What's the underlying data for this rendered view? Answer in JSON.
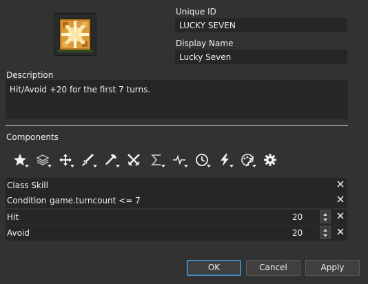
{
  "skill": {
    "unique_id_label": "Unique ID",
    "unique_id": "LUCKY SEVEN",
    "display_name_label": "Display Name",
    "display_name": "Lucky Seven",
    "icon": "sparkle-skill-icon"
  },
  "description": {
    "label": "Description",
    "text": "Hit/Avoid +20 for the first 7 turns."
  },
  "components": {
    "label": "Components",
    "toolbar": [
      {
        "icon": "star-icon"
      },
      {
        "icon": "layers-icon"
      },
      {
        "icon": "move-arrows-icon"
      },
      {
        "icon": "sword-icon"
      },
      {
        "icon": "axe-icon"
      },
      {
        "icon": "crossed-swords-icon"
      },
      {
        "icon": "sigma-icon"
      },
      {
        "icon": "pulse-icon"
      },
      {
        "icon": "clock-icon"
      },
      {
        "icon": "lightning-icon"
      },
      {
        "icon": "palette-icon"
      },
      {
        "icon": "gear-icon"
      }
    ],
    "rows": [
      {
        "name": "Class Skill"
      },
      {
        "name": "Condition",
        "value": "game.turncount <= 7"
      },
      {
        "name": "Hit",
        "value": "20"
      },
      {
        "name": "Avoid",
        "value": "20"
      }
    ]
  },
  "buttons": {
    "ok": "OK",
    "cancel": "Cancel",
    "apply": "Apply"
  },
  "colors": {
    "background": "#323232",
    "field": "#262626",
    "focus_accent": "#4aa0e0"
  }
}
